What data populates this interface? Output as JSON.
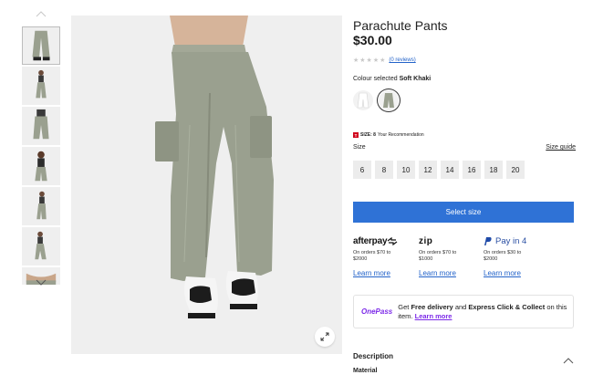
{
  "gallery": {
    "thumbnails": [
      {
        "name": "thumb-front"
      },
      {
        "name": "thumb-full"
      },
      {
        "name": "thumb-back"
      },
      {
        "name": "thumb-top"
      },
      {
        "name": "thumb-side"
      },
      {
        "name": "thumb-walk"
      },
      {
        "name": "thumb-detail"
      }
    ],
    "selected_index": 0,
    "icons": {
      "up": "chevron-up-icon",
      "down": "chevron-down-icon",
      "expand": "expand-icon"
    }
  },
  "product": {
    "title": "Parachute Pants",
    "price": "$30.00",
    "stars": "★★★★★",
    "reviews_link": "(0 reviews)",
    "colour_prefix": "Colour selected",
    "colour_name": "Soft Khaki",
    "swatches": [
      "white",
      "soft-khaki"
    ],
    "selected_swatch": "soft-khaki"
  },
  "sizing": {
    "rec_logo": "T",
    "rec_size_label": "SIZE: 8",
    "rec_text": "Your Recommendation",
    "size_label": "Size",
    "size_guide": "Size guide",
    "sizes": [
      "6",
      "8",
      "10",
      "12",
      "14",
      "16",
      "18",
      "20"
    ]
  },
  "cta": {
    "select_size": "Select size"
  },
  "payments": {
    "afterpay": {
      "logo": "afterpay",
      "line1": "On orders $70 to",
      "line2": "$2000",
      "link": "Learn more"
    },
    "zip": {
      "logo": "zip",
      "line1": "On orders $70 to",
      "line2": "$1000",
      "link": "Learn more"
    },
    "paypal": {
      "logo": "Pay in 4",
      "line1": "On orders $30 to",
      "line2": "$2000",
      "link": "Learn more"
    }
  },
  "onepass": {
    "logo": "OnePass",
    "get": "Get",
    "free_delivery": "Free delivery",
    "and": "and",
    "express": "Express Click & Collect",
    "on_item": "on this item.",
    "learn_more": "Learn more"
  },
  "details": {
    "description": "Description",
    "material": "Material"
  },
  "colors": {
    "accent": "#2f72d6",
    "onepass": "#7c2ae8",
    "link": "#2363c9",
    "product": "#9aa08f"
  }
}
